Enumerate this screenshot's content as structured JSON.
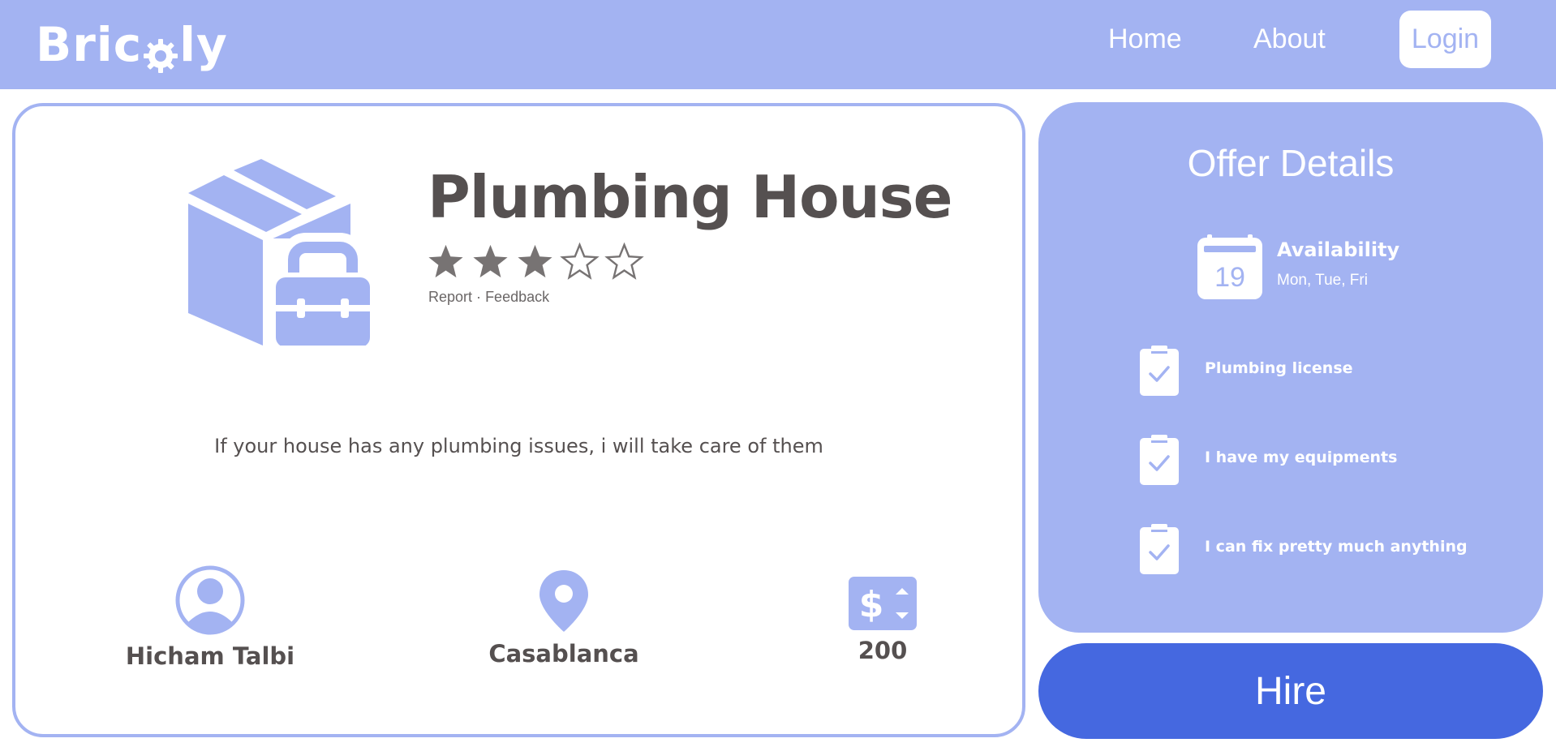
{
  "navbar": {
    "logo_pre": "Bric",
    "logo_post": "ly",
    "links": [
      "Home",
      "About"
    ],
    "login_label": "Login"
  },
  "colors": {
    "accent": "#a3b3f2",
    "primary": "#4568e0",
    "text": "#555050",
    "background": "#ffffff"
  },
  "service": {
    "icon": "box-toolbox-icon",
    "title": "Plumbing House",
    "rating": 3,
    "rating_max": 5,
    "report_label": "Report",
    "separator": "·",
    "feedback_label": "Feedback",
    "description": "If your house has any plumbing issues, i will take care of them",
    "provider_name": "Hicham Talbi",
    "city": "Casablanca",
    "price": "200"
  },
  "offer": {
    "title": "Offer Details",
    "availability_label": "Availability",
    "availability_days": "Mon, Tue, Fri",
    "calendar_day": "19",
    "requirements": [
      "Plumbing license",
      "I have my equipments",
      "I can fix pretty much anything"
    ]
  },
  "hire_label": "Hire"
}
